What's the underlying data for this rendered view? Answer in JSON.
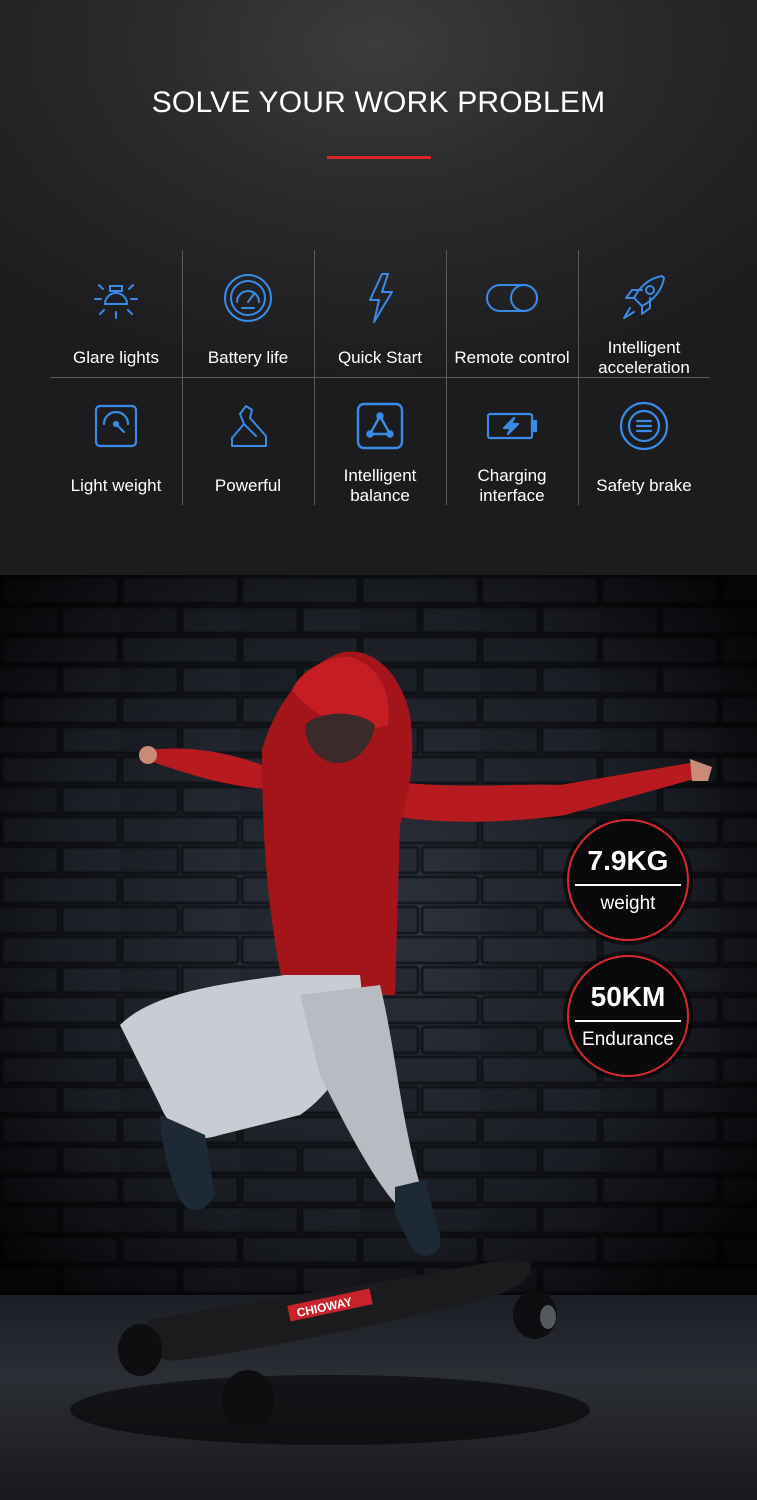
{
  "header": {
    "title": "SOLVE YOUR WORK PROBLEM"
  },
  "features": [
    {
      "label": "Glare lights",
      "icon": "light-bulb-icon"
    },
    {
      "label": "Battery life",
      "icon": "speedometer-icon"
    },
    {
      "label": "Quick Start",
      "icon": "lightning-bolt-icon"
    },
    {
      "label": "Remote control",
      "icon": "toggle-icon"
    },
    {
      "label": "Intelligent acceleration",
      "icon": "rocket-icon"
    },
    {
      "label": "Light weight",
      "icon": "weight-scale-icon"
    },
    {
      "label": "Powerful",
      "icon": "arm-power-icon"
    },
    {
      "label": "Intelligent balance",
      "icon": "balance-triangle-icon"
    },
    {
      "label": "Charging interface",
      "icon": "battery-charging-icon"
    },
    {
      "label": "Safety brake",
      "icon": "brake-icon"
    }
  ],
  "hero": {
    "board_brand": "CHIOWAY",
    "stats": [
      {
        "value": "7.9KG",
        "label": "weight"
      },
      {
        "value": "50KM",
        "label": "Endurance"
      }
    ]
  },
  "colors": {
    "accent_red": "#d8262c",
    "icon_blue": "#3a8be8"
  }
}
